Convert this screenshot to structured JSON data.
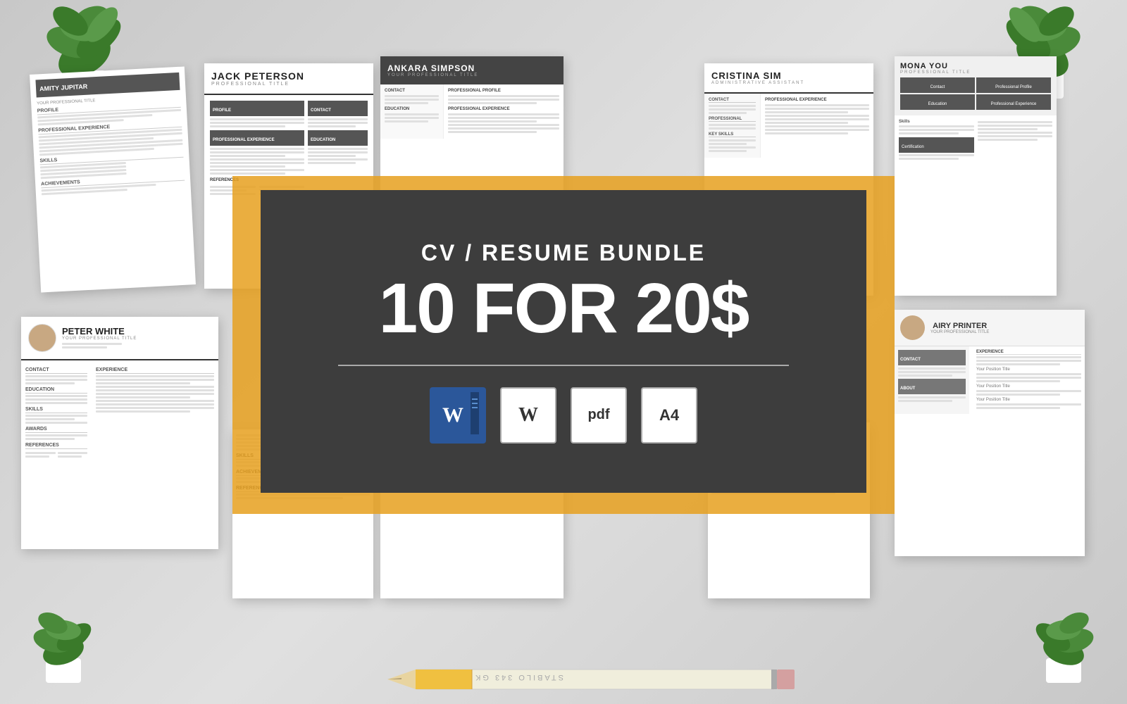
{
  "page": {
    "background_color": "#d5d5d5",
    "title": "CV Resume Bundle - 10 for 20$"
  },
  "banner": {
    "subtitle": "CV / RESUME BUNDLE",
    "title": "10 FOR 20$",
    "divider": true,
    "formats": [
      "Word",
      "W",
      "pdf",
      "A4"
    ]
  },
  "resumes": [
    {
      "name": "AMITY JUPITAR",
      "title": "YOUR PROFESSIONAL TITLE",
      "position": "top-left"
    },
    {
      "name": "JACK PETERSON",
      "title": "PROFESSIONAL TITLE",
      "position": "center-left"
    },
    {
      "name": "ANKARA SIMPSON",
      "title": "YOUR PROFESSIONAL TITLE",
      "position": "center"
    },
    {
      "name": "CRISTINA SIM",
      "title": "ADMINISTRATIVE ASSISTANT",
      "position": "center-right"
    },
    {
      "name": "MONA YOU",
      "title": "PROFESSIONAL TITLE",
      "position": "top-right"
    },
    {
      "name": "PETER WHITE",
      "title": "YOUR PROFESSIONAL TITLE",
      "position": "bottom-left"
    },
    {
      "name": "AIRY PRINTER",
      "title": "YOUR PROFESSIONAL TITLE",
      "position": "bottom-right"
    }
  ],
  "pencil": {
    "brand": "STABILO 343 GK",
    "color": "#f5f0e0"
  },
  "plants": [
    {
      "position": "top-left"
    },
    {
      "position": "top-right"
    },
    {
      "position": "bottom-left"
    },
    {
      "position": "bottom-right"
    }
  ]
}
